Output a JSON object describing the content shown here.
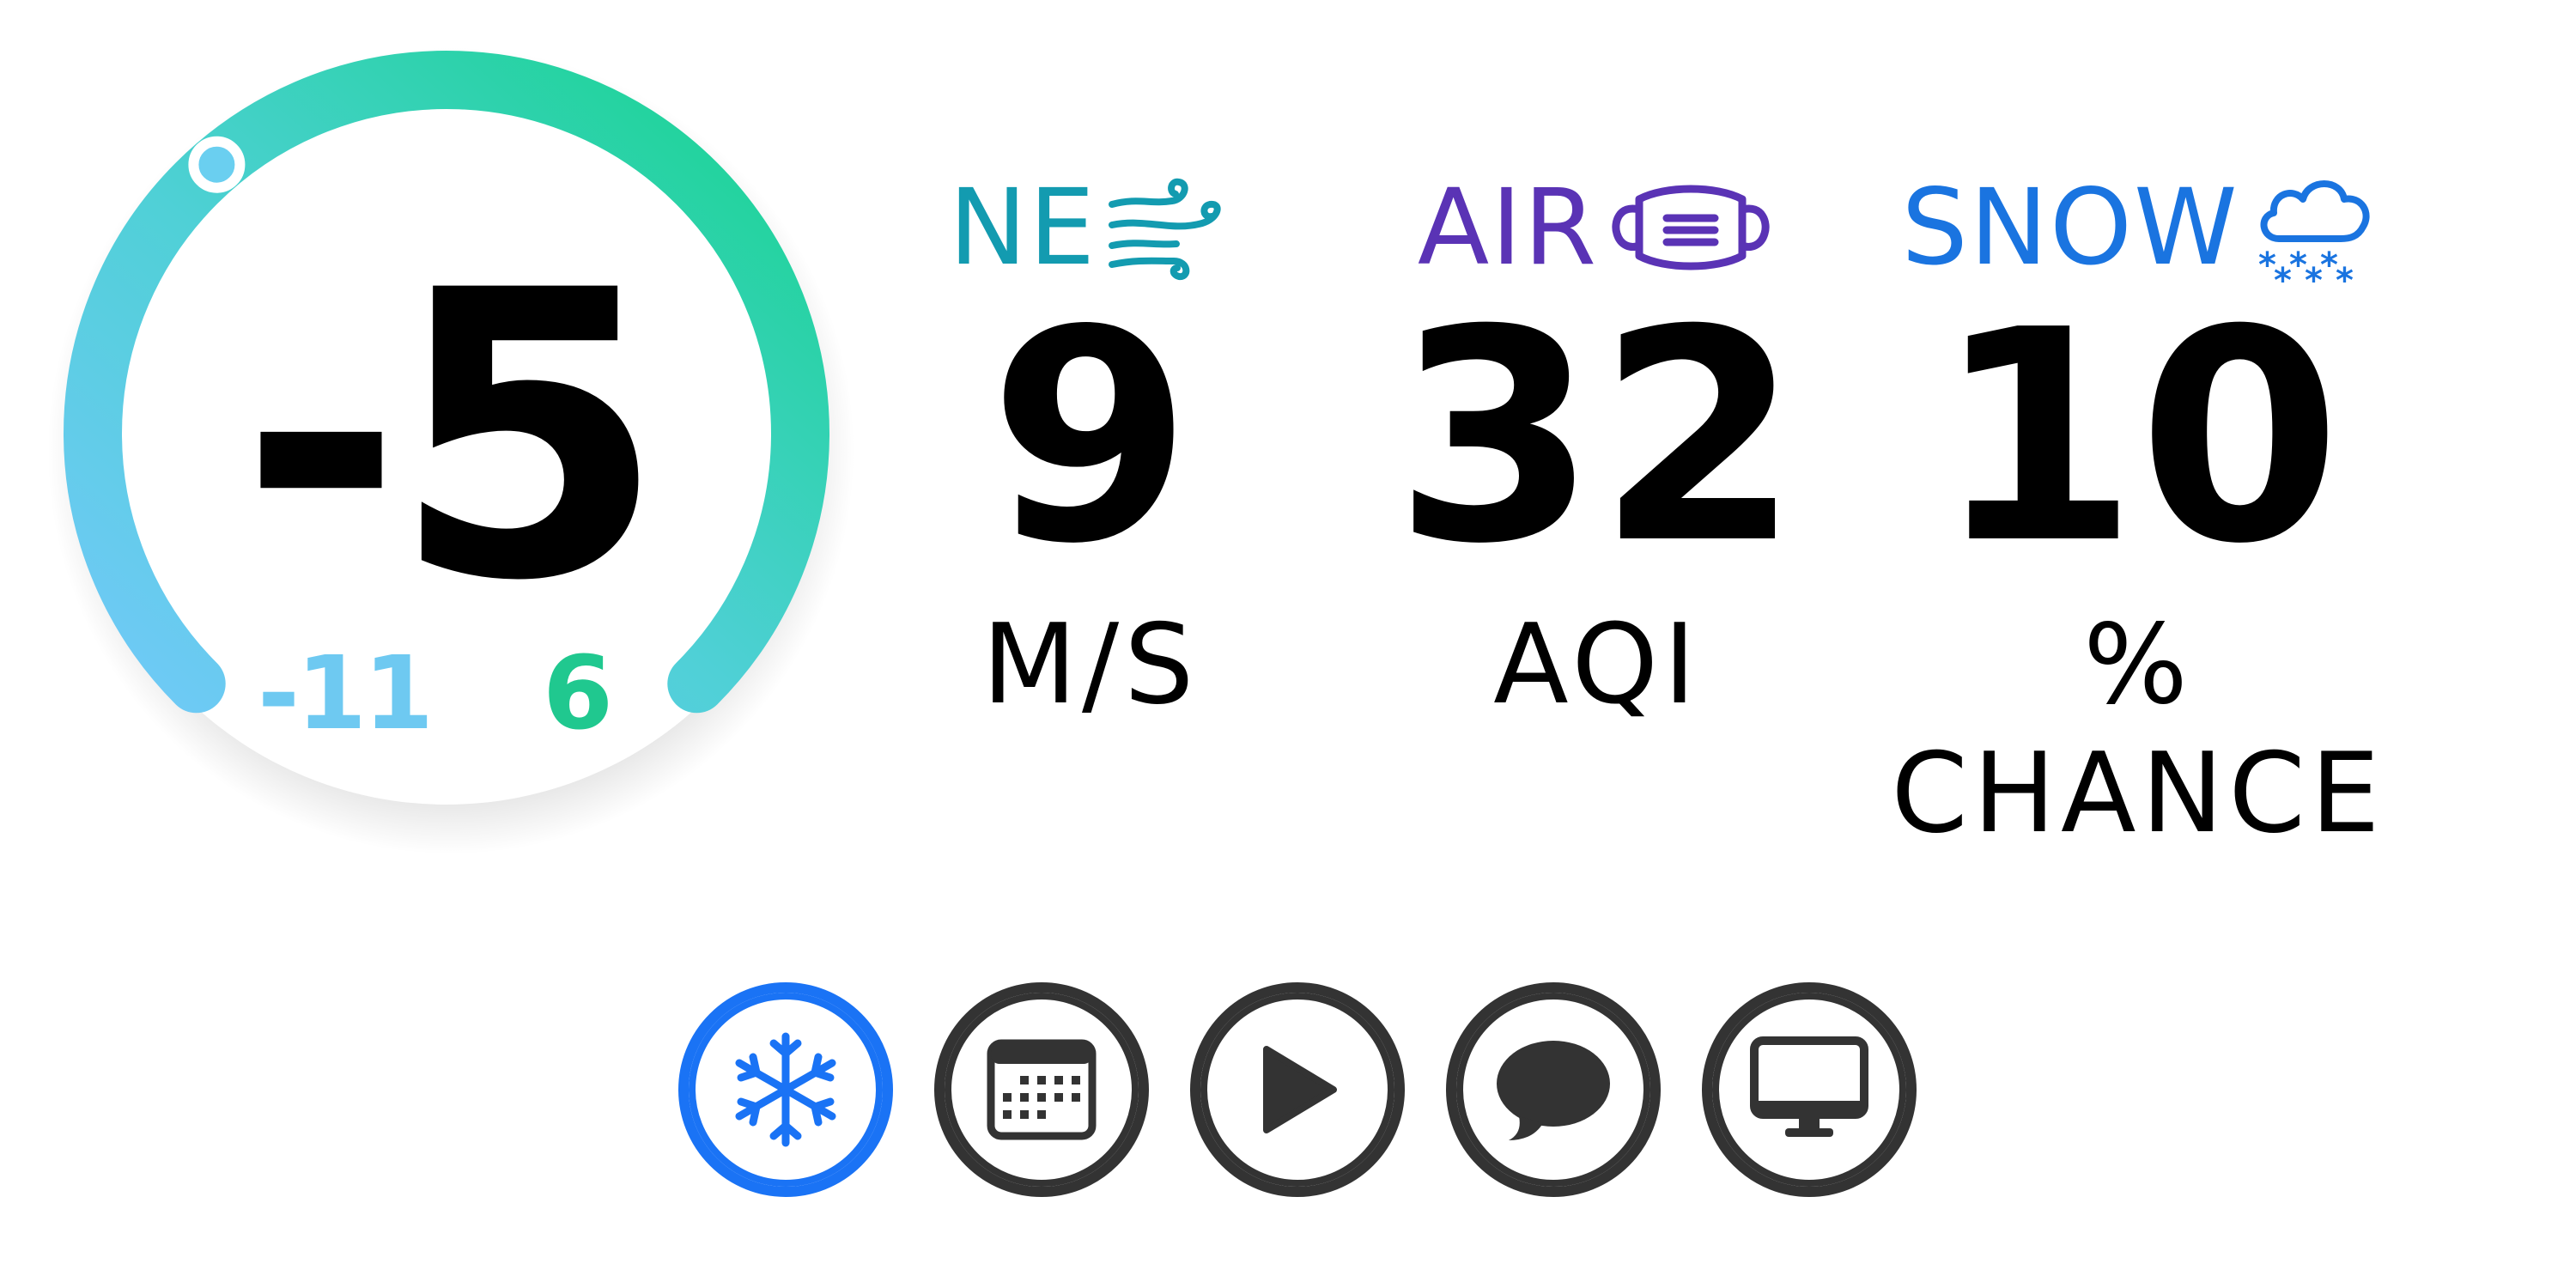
{
  "gauge": {
    "value": "-5",
    "min": "-11",
    "max": "6",
    "level": 0.35,
    "colors": {
      "start": "#71c9f8",
      "end": "#16d48e"
    }
  },
  "stats": {
    "wind": {
      "title": "NE",
      "value": "9",
      "unit": "M/S",
      "icon": "wind-icon",
      "color": "#139bb0"
    },
    "air": {
      "title": "AIR",
      "value": "32",
      "unit": "AQI",
      "icon": "mask-icon",
      "color": "#5a33b5"
    },
    "snow": {
      "title": "SNOW",
      "value": "10",
      "unit": "% CHANCE",
      "icon": "cloud-snow-icon",
      "color": "#1a74e0"
    }
  },
  "nav": [
    {
      "icon": "snowflake-icon",
      "selected": true,
      "color": "#1a73f5"
    },
    {
      "icon": "calendar-icon",
      "selected": false,
      "color": "#333333"
    },
    {
      "icon": "play-icon",
      "selected": false,
      "color": "#333333"
    },
    {
      "icon": "speech-bubble-icon",
      "selected": false,
      "color": "#333333"
    },
    {
      "icon": "display-icon",
      "selected": false,
      "color": "#333333"
    }
  ]
}
